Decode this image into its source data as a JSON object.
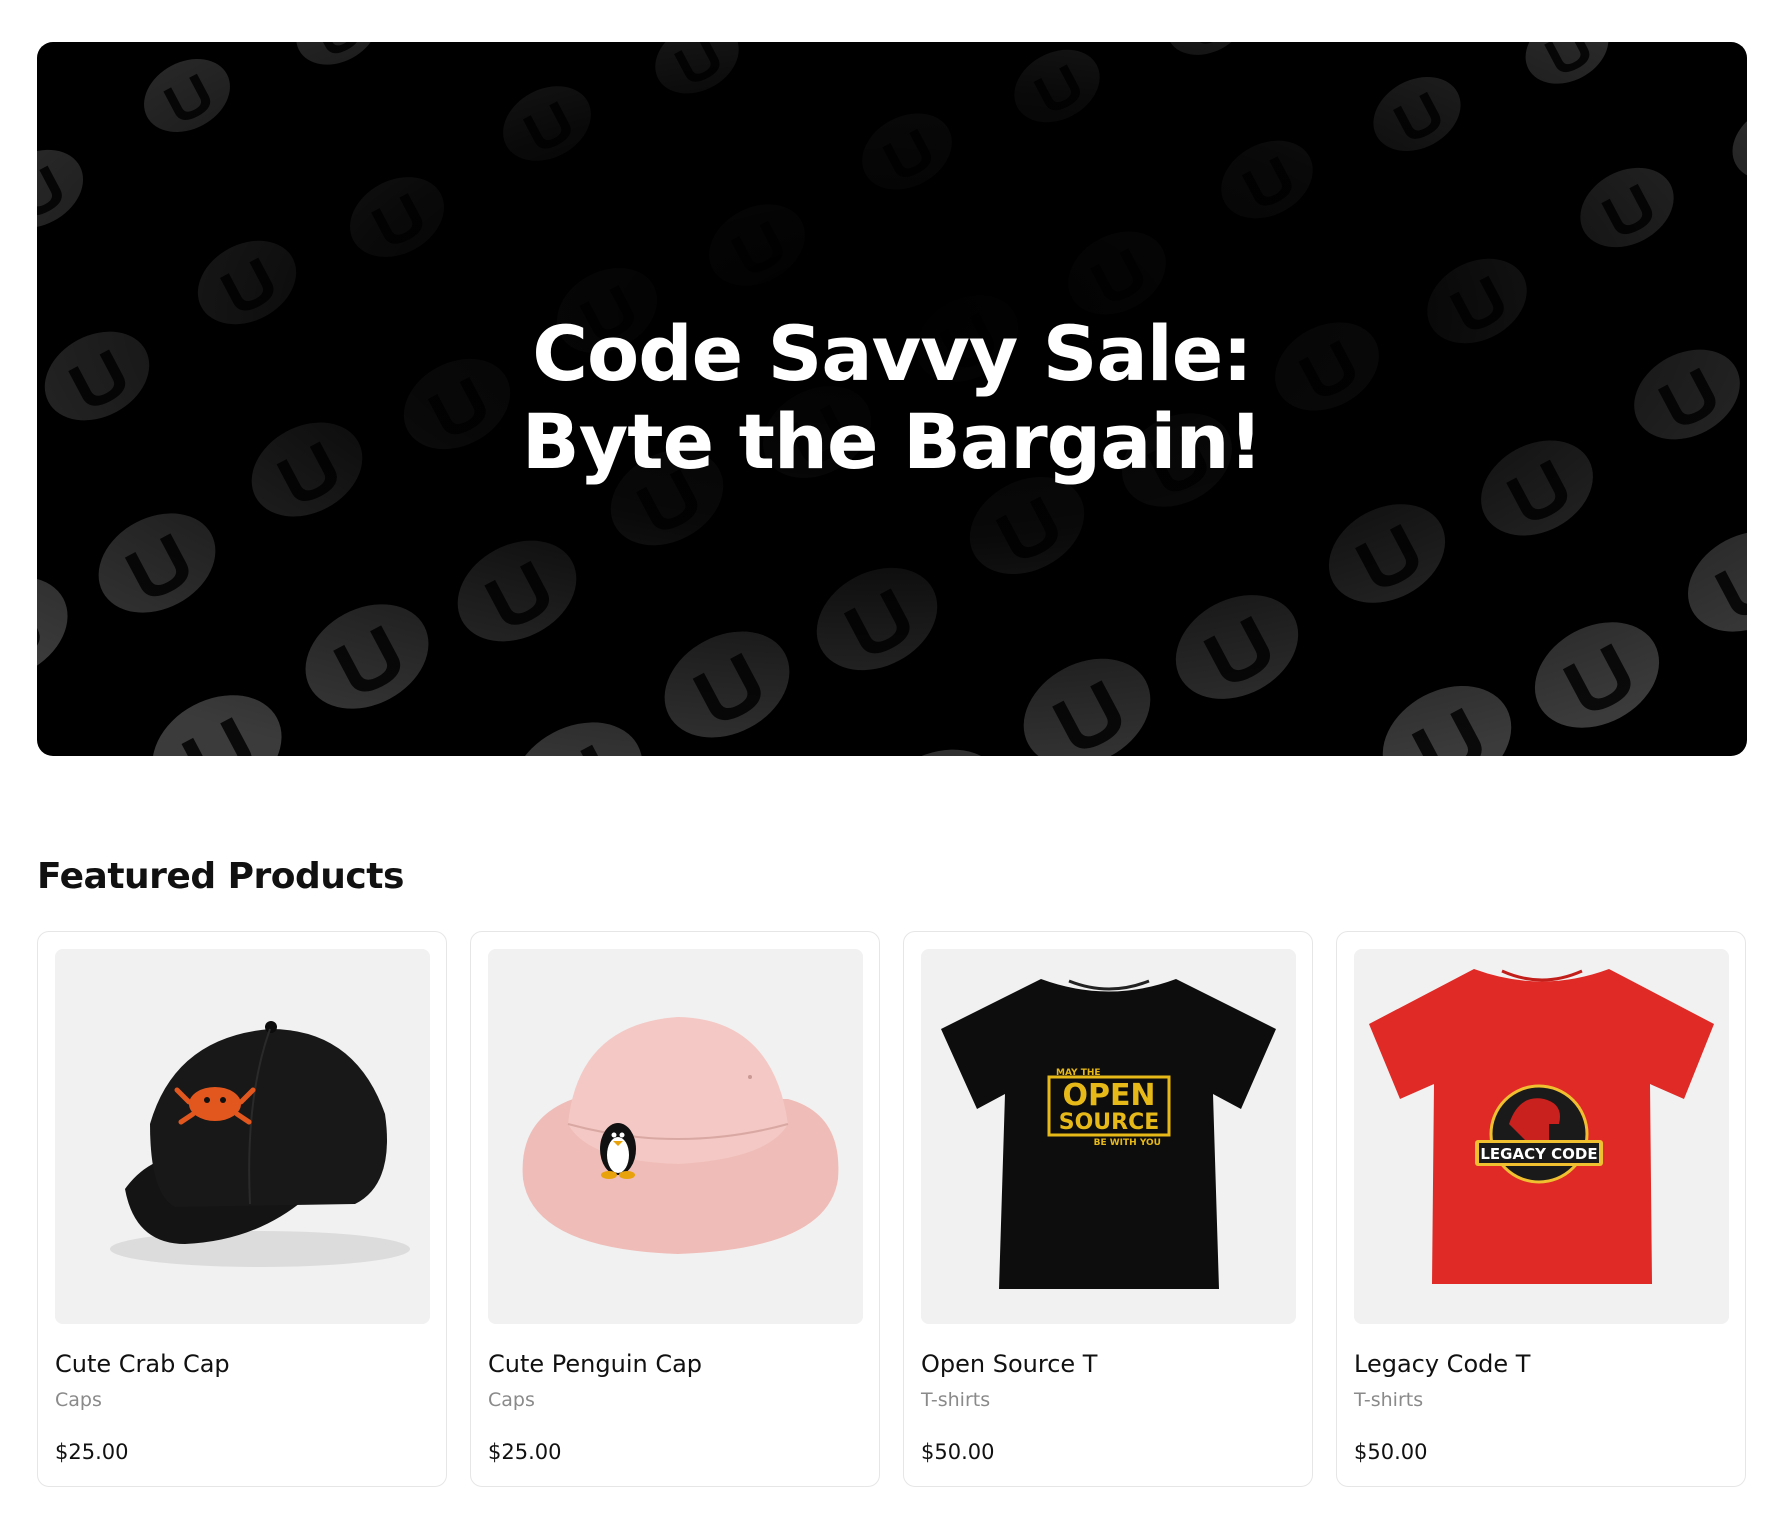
{
  "hero": {
    "line1": "Code Savvy Sale:",
    "line2": "Byte the Bargain!",
    "background": "#000000",
    "pattern_color": "#3a3a3a"
  },
  "featured": {
    "title": "Featured Products",
    "products": [
      {
        "name": "Cute Crab Cap",
        "category": "Caps",
        "price": "$25.00",
        "image": "black-cap-crab",
        "color": "#111111"
      },
      {
        "name": "Cute Penguin Cap",
        "category": "Caps",
        "price": "$25.00",
        "image": "pink-bucket-hat-penguin",
        "color": "#f3c6c2"
      },
      {
        "name": "Open Source T",
        "category": "T-shirts",
        "price": "$50.00",
        "image": "black-tshirt-open-source",
        "color": "#0d0d0d",
        "print": {
          "top": "MAY THE",
          "main1": "OPEN",
          "main2": "SOURCE",
          "bottom": "BE WITH YOU"
        }
      },
      {
        "name": "Legacy Code T",
        "category": "T-shirts",
        "price": "$50.00",
        "image": "red-tshirt-legacy-code",
        "color": "#e02b27",
        "print": {
          "main": "LEGACY CODE"
        }
      }
    ]
  }
}
